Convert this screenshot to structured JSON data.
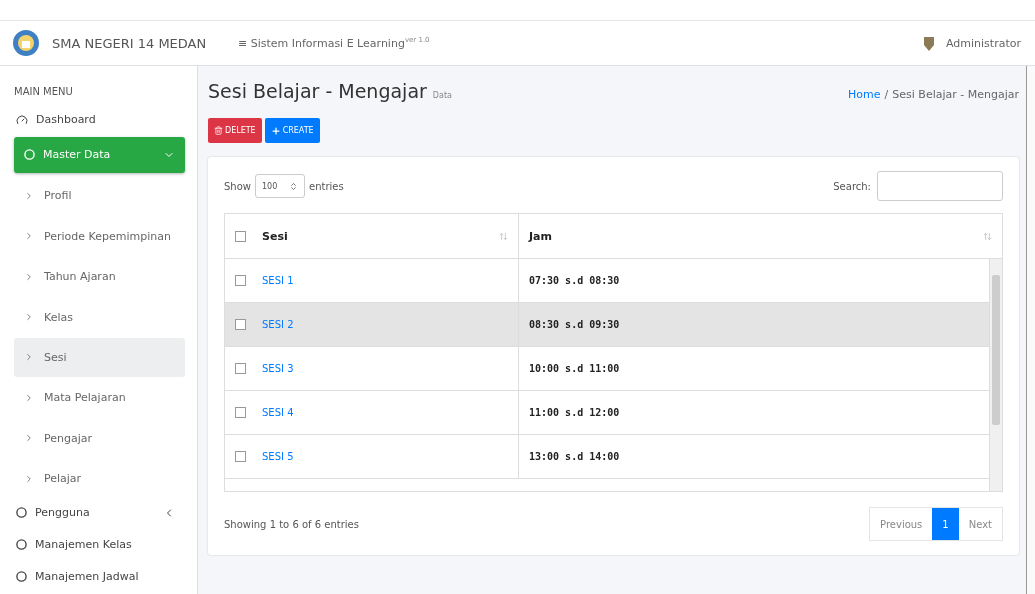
{
  "header": {
    "school": "SMA NEGERI 14 MEDAN",
    "menu_glyph": "≡",
    "app_title": "Sistem Informasi E Learning",
    "version": "ver 1.0",
    "user": "Administrator"
  },
  "sidebar": {
    "heading": "MAIN MENU",
    "items": [
      {
        "kind": "icon",
        "label": "Dashboard",
        "active": false
      },
      {
        "kind": "group",
        "label": "Master Data",
        "active": true,
        "expanded": true,
        "children": [
          {
            "label": "Profil",
            "selected": false
          },
          {
            "label": "Periode Kepemimpinan",
            "selected": false
          },
          {
            "label": "Tahun Ajaran",
            "selected": false
          },
          {
            "label": "Kelas",
            "selected": false
          },
          {
            "label": "Sesi",
            "selected": true
          },
          {
            "label": "Mata Pelajaran",
            "selected": false
          },
          {
            "label": "Pengajar",
            "selected": false
          },
          {
            "label": "Pelajar",
            "selected": false
          }
        ]
      },
      {
        "kind": "group",
        "label": "Pengguna",
        "active": false,
        "expanded": false
      },
      {
        "kind": "circle",
        "label": "Manajemen Kelas",
        "active": false
      },
      {
        "kind": "circle",
        "label": "Manajemen Jadwal",
        "active": false
      }
    ]
  },
  "page": {
    "title": "Sesi Belajar - Mengajar",
    "subtitle": "Data",
    "breadcrumb": [
      {
        "label": "Home",
        "link": true
      },
      {
        "label": "Sesi Belajar - Mengajar",
        "link": false
      }
    ],
    "separator": "/"
  },
  "actions": [
    {
      "kind": "delete",
      "label": "DELETE"
    },
    {
      "kind": "create",
      "label": "CREATE"
    }
  ],
  "table_controls": {
    "show": "Show",
    "page_size": "100",
    "entries": "entries",
    "search_label": "Search:"
  },
  "table": {
    "columns": [
      {
        "label": "Sesi"
      },
      {
        "label": "Jam"
      }
    ],
    "all_checked": false,
    "rows": [
      {
        "sesi": "SESI 1",
        "jam": "07:30 s.d 08:30",
        "checked": false,
        "highlighted": false
      },
      {
        "sesi": "SESI 2",
        "jam": "08:30 s.d 09:30",
        "checked": false,
        "highlighted": true
      },
      {
        "sesi": "SESI 3",
        "jam": "10:00 s.d 11:00",
        "checked": false,
        "highlighted": false
      },
      {
        "sesi": "SESI 4",
        "jam": "11:00 s.d 12:00",
        "checked": false,
        "highlighted": false
      },
      {
        "sesi": "SESI 5",
        "jam": "13:00 s.d 14:00",
        "checked": false,
        "highlighted": false
      }
    ]
  },
  "footer": {
    "info": "Showing 1 to 6 of 6 entries",
    "pages": [
      {
        "label": "Previous",
        "selected": false
      },
      {
        "label": "1",
        "selected": true
      },
      {
        "label": "Next",
        "selected": false
      }
    ]
  }
}
